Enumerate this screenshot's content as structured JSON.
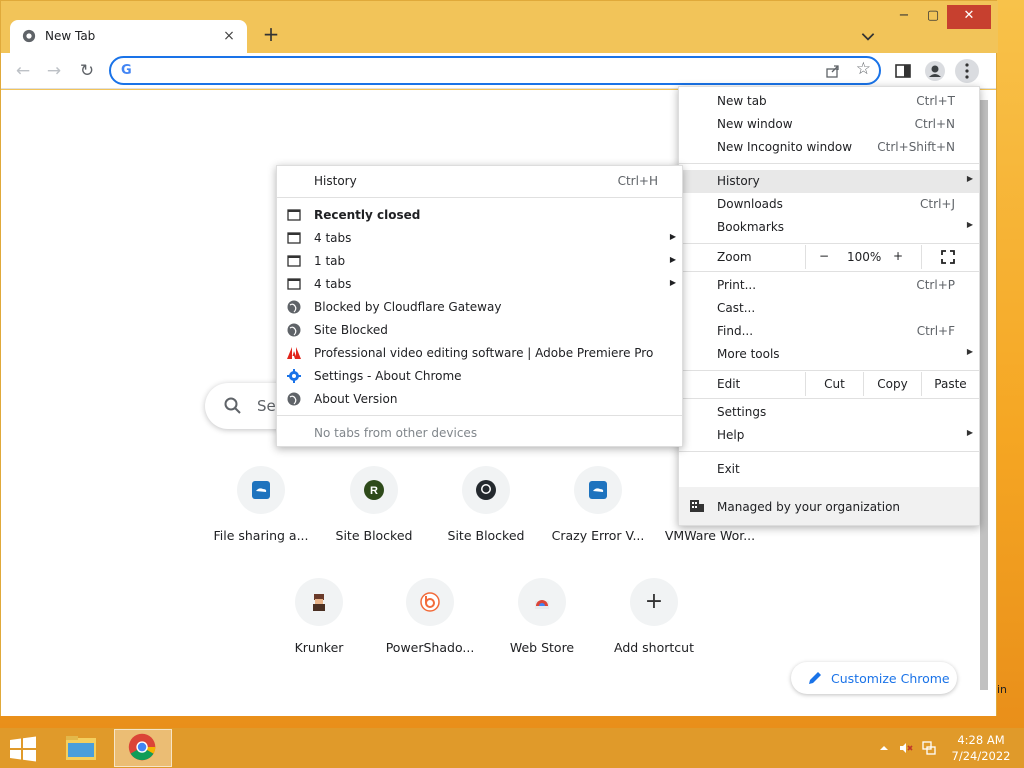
{
  "window": {
    "tab_title": "New Tab",
    "close_tab": "×",
    "new_tab": "+",
    "minimize": "−",
    "maximize": "▢",
    "close": "✕"
  },
  "toolbar": {
    "back": "←",
    "forward": "→",
    "reload": "↻",
    "google_g": "G",
    "address_value": "",
    "star": "☆"
  },
  "ntp": {
    "search_placeholder": "Se",
    "shortcuts": [
      {
        "label": "File sharing a...",
        "icon": "cloud-blue-icon"
      },
      {
        "label": "Site Blocked",
        "icon": "letter-r-icon",
        "letter": "R"
      },
      {
        "label": "Site Blocked",
        "icon": "github-icon"
      },
      {
        "label": "Crazy Error V...",
        "icon": "cloud-blue-icon"
      },
      {
        "label": "VMWare Wor...",
        "icon": "none"
      },
      {
        "label": "Krunker",
        "icon": "krunker-icon"
      },
      {
        "label": "PowerShado...",
        "icon": "powershadow-icon"
      },
      {
        "label": "Web Store",
        "icon": "webstore-icon"
      },
      {
        "label": "Add shortcut",
        "icon": "plus-icon",
        "glyph": "+"
      }
    ],
    "customize_label": "Customize Chrome",
    "edge_text": "in"
  },
  "menu": {
    "items_top": [
      {
        "label": "New tab",
        "shortcut": "Ctrl+T"
      },
      {
        "label": "New window",
        "shortcut": "Ctrl+N"
      },
      {
        "label": "New Incognito window",
        "shortcut": "Ctrl+Shift+N"
      }
    ],
    "history": "History",
    "downloads": "Downloads",
    "downloads_shortcut": "Ctrl+J",
    "bookmarks": "Bookmarks",
    "zoom": {
      "label": "Zoom",
      "minus": "−",
      "value": "100%",
      "plus": "+"
    },
    "print": "Print...",
    "print_shortcut": "Ctrl+P",
    "cast": "Cast...",
    "find": "Find...",
    "find_shortcut": "Ctrl+F",
    "more_tools": "More tools",
    "edit": {
      "label": "Edit",
      "cut": "Cut",
      "copy": "Copy",
      "paste": "Paste"
    },
    "settings": "Settings",
    "help": "Help",
    "exit": "Exit",
    "managed": "Managed by your organization"
  },
  "history_menu": {
    "title": "History",
    "title_shortcut": "Ctrl+H",
    "recently_closed": "Recently closed",
    "items": [
      {
        "label": "4 tabs",
        "icon": "window-icon",
        "submenu": true
      },
      {
        "label": "1 tab",
        "icon": "window-icon",
        "submenu": true
      },
      {
        "label": "4 tabs",
        "icon": "window-icon",
        "submenu": true
      },
      {
        "label": "Blocked by Cloudflare Gateway",
        "icon": "globe-icon"
      },
      {
        "label": "Site Blocked",
        "icon": "globe-icon"
      },
      {
        "label": "Professional video editing software | Adobe Premiere Pro",
        "icon": "adobe-icon"
      },
      {
        "label": "Settings - About Chrome",
        "icon": "settings-gear-icon"
      },
      {
        "label": "About Version",
        "icon": "globe-icon"
      }
    ],
    "no_tabs": "No tabs from other devices"
  },
  "taskbar": {
    "time": "4:28 AM",
    "date": "7/24/2022"
  },
  "colors": {
    "accent": "#1a73e8",
    "desktop": "#f5a623",
    "close_red": "#c7402f"
  }
}
